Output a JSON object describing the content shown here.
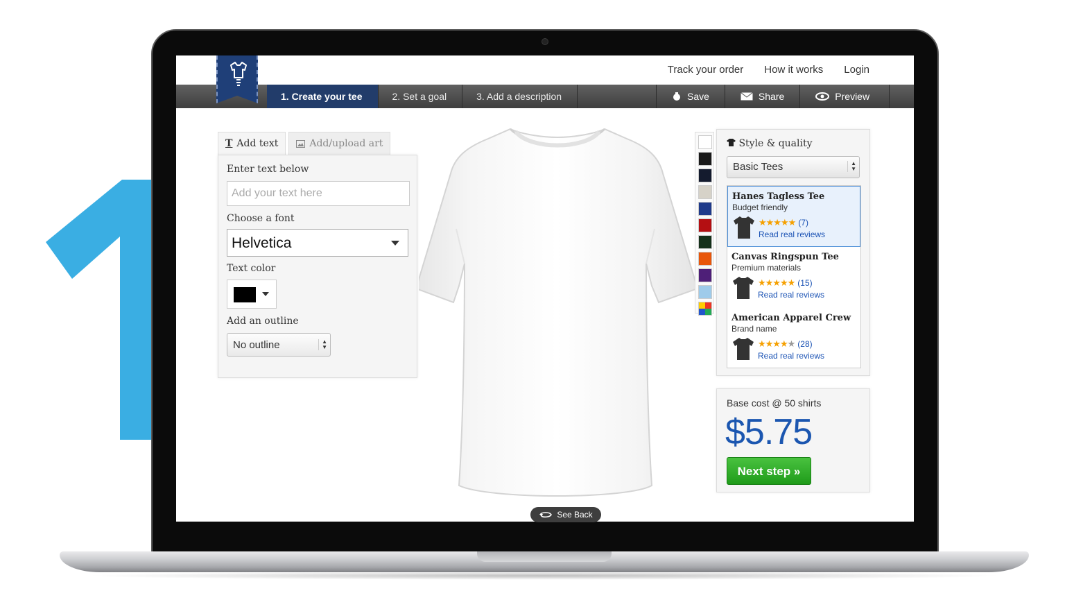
{
  "step_number": "1",
  "header": {
    "links": [
      "Track your order",
      "How it works",
      "Login"
    ]
  },
  "steps": [
    {
      "label": "1. Create your tee",
      "active": true
    },
    {
      "label": "2. Set a goal",
      "active": false
    },
    {
      "label": "3. Add a description",
      "active": false
    }
  ],
  "actions": {
    "save": "Save",
    "share": "Share",
    "preview": "Preview"
  },
  "left_panel": {
    "tab_text": "Add text",
    "tab_art": "Add/upload art",
    "enter_text_label": "Enter text below",
    "text_placeholder": "Add your text here",
    "font_label": "Choose a font",
    "font_value": "Helvetica",
    "color_label": "Text color",
    "text_color": "#000000",
    "outline_label": "Add an outline",
    "outline_value": "No outline"
  },
  "swatches": [
    "#ffffff",
    "#1a1a1a",
    "#141b2e",
    "#d6d2c8",
    "#1f3a8a",
    "#b40f12",
    "#15301a",
    "#e8560a",
    "#4e1f78",
    "#9ecbea",
    "multicolor"
  ],
  "style_panel": {
    "title": "Style & quality",
    "style_value": "Basic Tees",
    "products": [
      {
        "name": "Hanes Tagless Tee",
        "subtitle": "Budget friendly",
        "rating": 5,
        "count": "(7)",
        "reviews": "Read real reviews",
        "selected": true
      },
      {
        "name": "Canvas Ringspun Tee",
        "subtitle": "Premium materials",
        "rating": 5,
        "count": "(15)",
        "reviews": "Read real reviews",
        "selected": false
      },
      {
        "name": "American Apparel Crew",
        "subtitle": "Brand name",
        "rating": 4,
        "count": "(28)",
        "reviews": "Read real reviews",
        "selected": false
      }
    ]
  },
  "cost": {
    "label": "Base cost @ 50 shirts",
    "price": "$5.75",
    "next_button": "Next step »"
  },
  "see_back": "See Back",
  "colors": {
    "accent_blue": "#3aaee3",
    "nav_active": "#223c6a",
    "price_blue": "#1b56b0",
    "next_green": "#2fae28"
  }
}
